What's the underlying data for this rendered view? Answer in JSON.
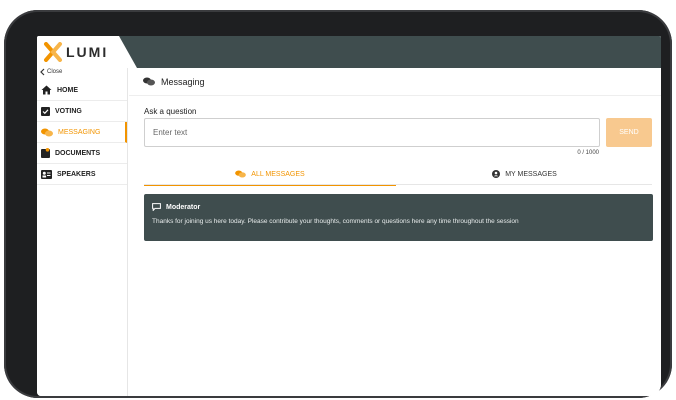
{
  "app": {
    "logo_text": "LUMI",
    "brand_color": "#f29400",
    "bar_color": "#3f4d4e"
  },
  "sidebar": {
    "close_label": "Close",
    "items": [
      {
        "label": "HOME",
        "icon": "home-icon"
      },
      {
        "label": "VOTING",
        "icon": "voting-icon"
      },
      {
        "label": "MESSAGING",
        "icon": "messaging-icon",
        "active": true
      },
      {
        "label": "DOCUMENTS",
        "icon": "documents-icon"
      },
      {
        "label": "SPEAKERS",
        "icon": "speakers-icon"
      }
    ]
  },
  "main": {
    "header_title": "Messaging",
    "ask_label": "Ask a question",
    "input_placeholder": "Enter text",
    "send_label": "SEND",
    "char_count": "0 / 1000",
    "tabs": [
      {
        "label": "ALL MESSAGES",
        "icon": "chat-bubbles-icon",
        "active": true
      },
      {
        "label": "MY MESSAGES",
        "icon": "user-circle-icon"
      }
    ],
    "messages": [
      {
        "author": "Moderator",
        "text": "Thanks for joining us here today. Please contribute your thoughts, comments or questions here any time throughout the session"
      }
    ]
  }
}
